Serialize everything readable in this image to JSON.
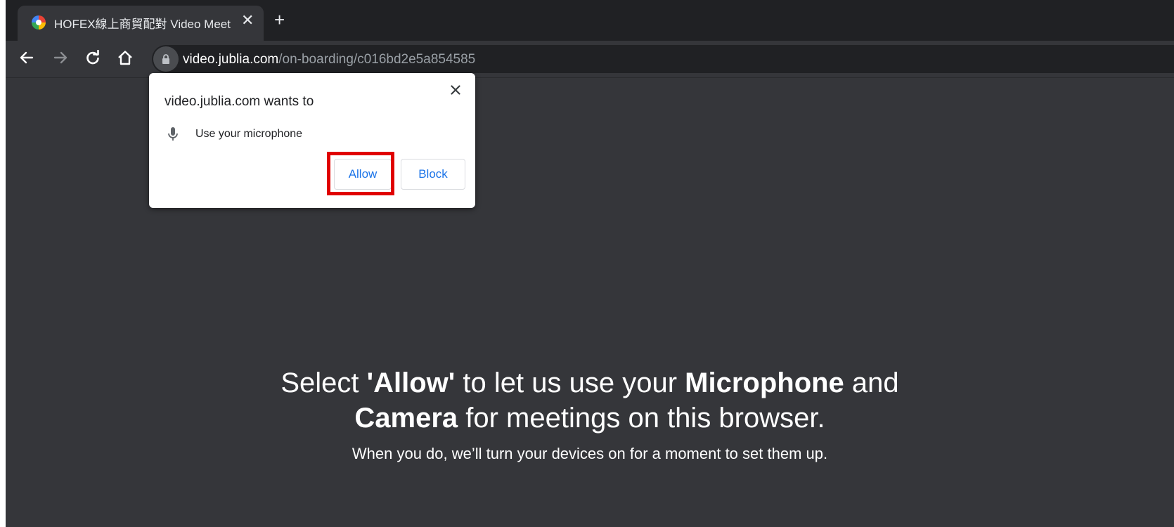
{
  "browser": {
    "tab": {
      "title": "HOFEX線上商貿配對 Video Meet",
      "close_label": "✕",
      "favicon": "globe-multicolor-icon"
    },
    "new_tab_label": "+",
    "nav_icons": [
      "back-arrow-icon",
      "forward-arrow-icon",
      "reload-icon",
      "home-icon"
    ],
    "address": {
      "domain": "video.jublia.com",
      "path": "/on-boarding/c016bd2e5a854585",
      "security_icon": "lock-icon"
    }
  },
  "permission_prompt": {
    "title": "video.jublia.com wants to",
    "close_label": "✕",
    "request": {
      "icon": "microphone-icon",
      "label": "Use your microphone"
    },
    "allow_label": "Allow",
    "block_label": "Block",
    "highlight_color": "#e00000"
  },
  "page": {
    "line1": {
      "part1": "Select ",
      "allow": "'Allow'",
      "part2": " to let us use your ",
      "microphone": "Microphone",
      "part3": " and"
    },
    "line2": {
      "camera": "Camera",
      "part1": " for meetings on this browser."
    },
    "subtitle": "When you do, we’ll turn your devices on for a moment to set them up."
  },
  "colors": {
    "page_background": "#35363a",
    "tabstrip_background": "#202124",
    "button_text": "#1a73e8"
  }
}
